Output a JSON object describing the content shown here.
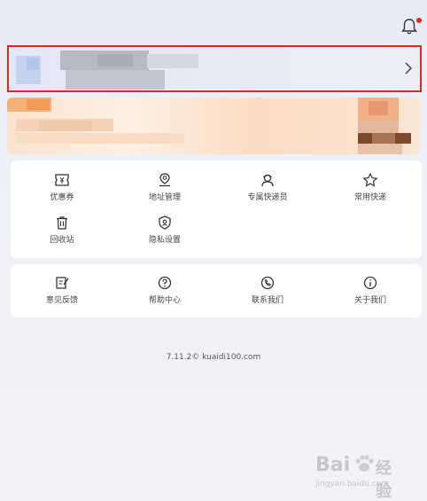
{
  "header": {
    "bell_icon": "bell-icon",
    "notification_dot_color": "#e0281e"
  },
  "profile": {
    "chevron_icon": "chevron-right-icon",
    "highlight_color": "#e0281e"
  },
  "menu_main": [
    {
      "label": "优惠券",
      "icon": "coupon-icon"
    },
    {
      "label": "地址管理",
      "icon": "location-pin-icon"
    },
    {
      "label": "专属快递员",
      "icon": "courier-icon"
    },
    {
      "label": "常用快递",
      "icon": "star-icon"
    },
    {
      "label": "回收站",
      "icon": "trash-icon"
    },
    {
      "label": "隐私设置",
      "icon": "shield-icon"
    }
  ],
  "menu_support": [
    {
      "label": "意见反馈",
      "icon": "feedback-icon"
    },
    {
      "label": "帮助中心",
      "icon": "help-icon"
    },
    {
      "label": "联系我们",
      "icon": "phone-icon"
    },
    {
      "label": "关于我们",
      "icon": "info-icon"
    }
  ],
  "footer": {
    "version": "7.11.2© kuaidi100.com"
  },
  "watermark": {
    "brand": "Bai",
    "sub": "jingyan.baidu.com"
  }
}
